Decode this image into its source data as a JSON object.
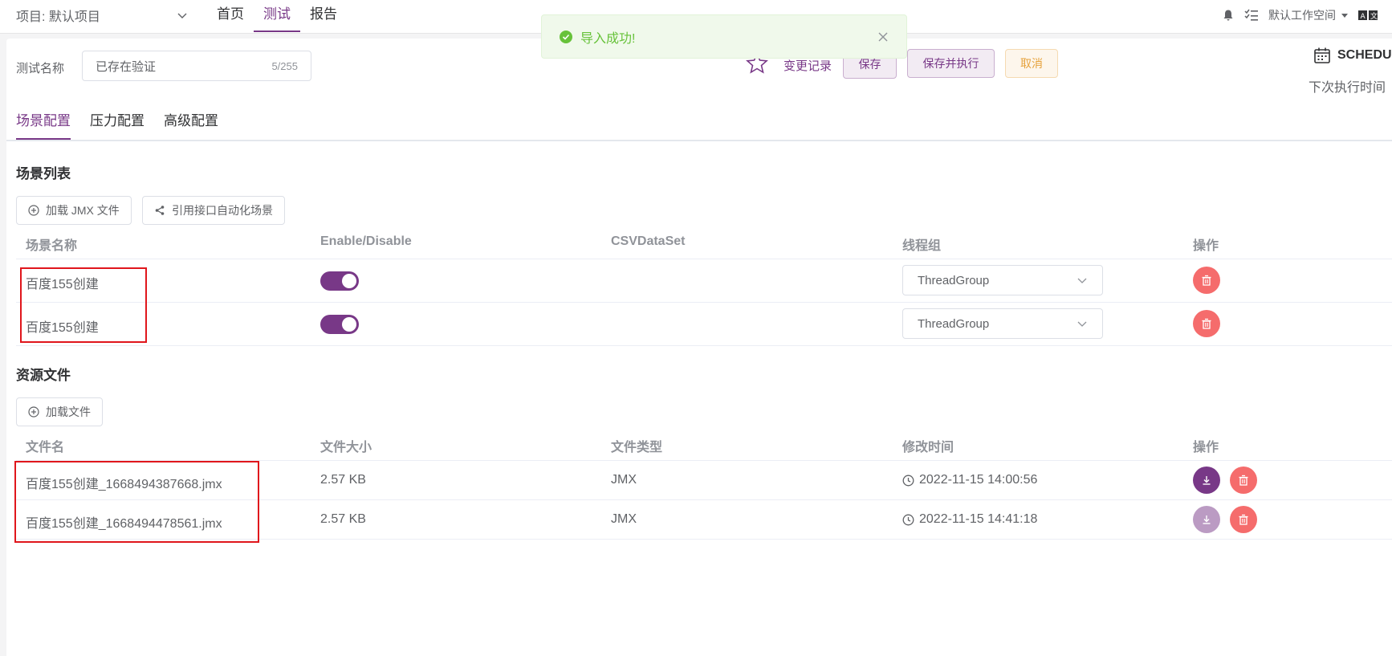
{
  "header": {
    "project_label": "项目: 默认项目",
    "nav": [
      "首页",
      "测试",
      "报告"
    ],
    "workspace": "默认工作空间"
  },
  "toast": {
    "message": "导入成功!"
  },
  "form": {
    "name_label": "测试名称",
    "name_value": "已存在验证",
    "name_count": "5/255",
    "change_log": "变更记录",
    "save": "保存",
    "save_run": "保存并执行",
    "cancel": "取消",
    "schedule": "SCHEDU",
    "next_run": "下次执行时间"
  },
  "tabs": [
    "场景配置",
    "压力配置",
    "高级配置"
  ],
  "scenarios": {
    "title": "场景列表",
    "load_jmx": "加载 JMX 文件",
    "reference": "引用接口自动化场景",
    "headers": [
      "场景名称",
      "Enable/Disable",
      "CSVDataSet",
      "线程组",
      "操作"
    ],
    "rows": [
      {
        "name": "百度155创建",
        "enabled": true,
        "thread_group": "ThreadGroup"
      },
      {
        "name": "百度155创建",
        "enabled": true,
        "thread_group": "ThreadGroup"
      }
    ]
  },
  "resources": {
    "title": "资源文件",
    "load_file": "加载文件",
    "headers": [
      "文件名",
      "文件大小",
      "文件类型",
      "修改时间",
      "操作"
    ],
    "rows": [
      {
        "file": "百度155创建_1668494387668.jmx",
        "size": "2.57 KB",
        "type": "JMX",
        "modified": "2022-11-15 14:00:56"
      },
      {
        "file": "百度155创建_1668494478561.jmx",
        "size": "2.57 KB",
        "type": "JMX",
        "modified": "2022-11-15 14:41:18"
      }
    ]
  },
  "colors": {
    "primary": "#783887",
    "danger": "#f56c6c",
    "success": "#67c23a",
    "highlight_box": "#e0161c"
  }
}
